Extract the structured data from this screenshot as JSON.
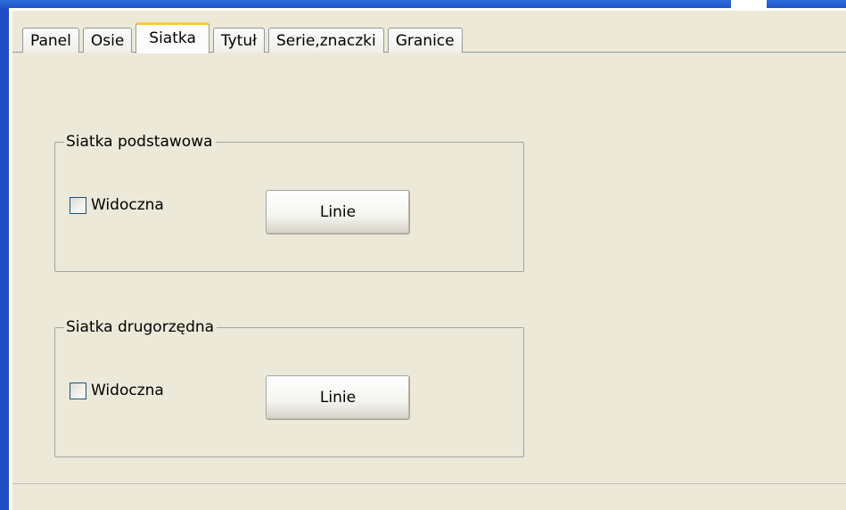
{
  "tabs": [
    {
      "label": "Panel",
      "active": false
    },
    {
      "label": "Osie",
      "active": false
    },
    {
      "label": "Siatka",
      "active": true
    },
    {
      "label": "Tytuł",
      "active": false
    },
    {
      "label": "Serie,znaczki",
      "active": false
    },
    {
      "label": "Granice",
      "active": false
    }
  ],
  "major_grid": {
    "title": "Siatka podstawowa",
    "visible_label": "Widoczna",
    "visible_checked": false,
    "lines_button": "Linie"
  },
  "minor_grid": {
    "title": "Siatka drugorzędna",
    "visible_label": "Widoczna",
    "visible_checked": false,
    "lines_button": "Linie"
  },
  "colors": {
    "dialog_bg": "#ece9d8",
    "title_bar": "#1f55c7",
    "active_tab_highlight": "#ffc83c"
  }
}
